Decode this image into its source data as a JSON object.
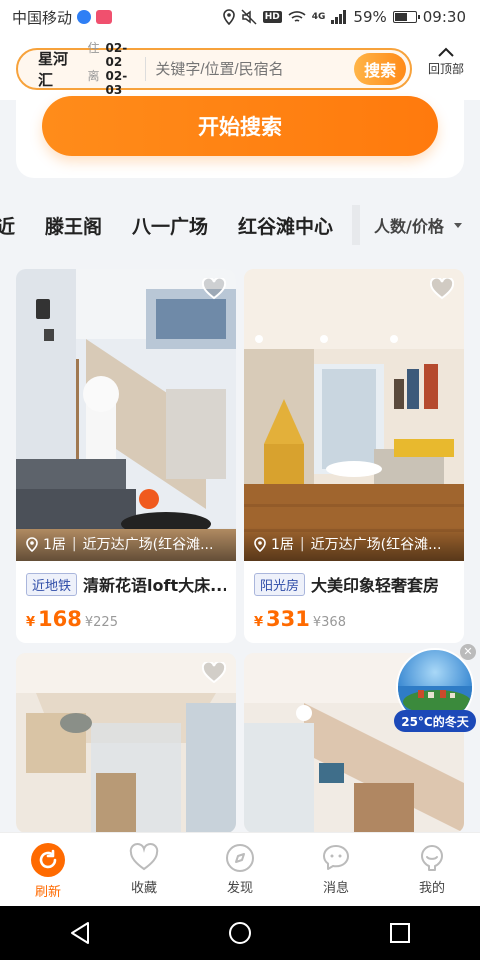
{
  "status_bar": {
    "carrier": "中国移动",
    "network": "4G",
    "battery": "59%",
    "battery_level": 0.59,
    "time": "09:30"
  },
  "search": {
    "city": "星河汇",
    "checkin_label": "住",
    "checkin_date": "02-02",
    "checkout_label": "离",
    "checkout_date": "02-03",
    "placeholder": "关键字/位置/民宿名",
    "button": "搜索"
  },
  "back_to_top": "回顶部",
  "start_search": "开始搜索",
  "tabs": [
    "近",
    "滕王阁",
    "八一广场",
    "红谷滩中心"
  ],
  "filter_label": "人数/价格",
  "listings": [
    {
      "rooms": "1居",
      "location": "近万达广场(红谷滩...",
      "tag": "近地铁",
      "title": "清新花语loft大床...",
      "currency": "¥",
      "price": "168",
      "original_price": "¥225"
    },
    {
      "rooms": "1居",
      "location": "近万达广场(红谷滩...",
      "tag": "阳光房",
      "title": "大美印象轻奢套房",
      "currency": "¥",
      "price": "331",
      "original_price": "¥368"
    }
  ],
  "promo": {
    "label": "25°C的冬天"
  },
  "bottom_nav": [
    {
      "label": "刷新",
      "icon": "refresh-icon",
      "active": true
    },
    {
      "label": "收藏",
      "icon": "heart-icon",
      "active": false
    },
    {
      "label": "发现",
      "icon": "compass-icon",
      "active": false
    },
    {
      "label": "消息",
      "icon": "chat-icon",
      "active": false
    },
    {
      "label": "我的",
      "icon": "profile-icon",
      "active": false
    }
  ],
  "colors": {
    "accent": "#ff8a18",
    "price": "#ff6a00",
    "tag": "#2f4da8"
  }
}
